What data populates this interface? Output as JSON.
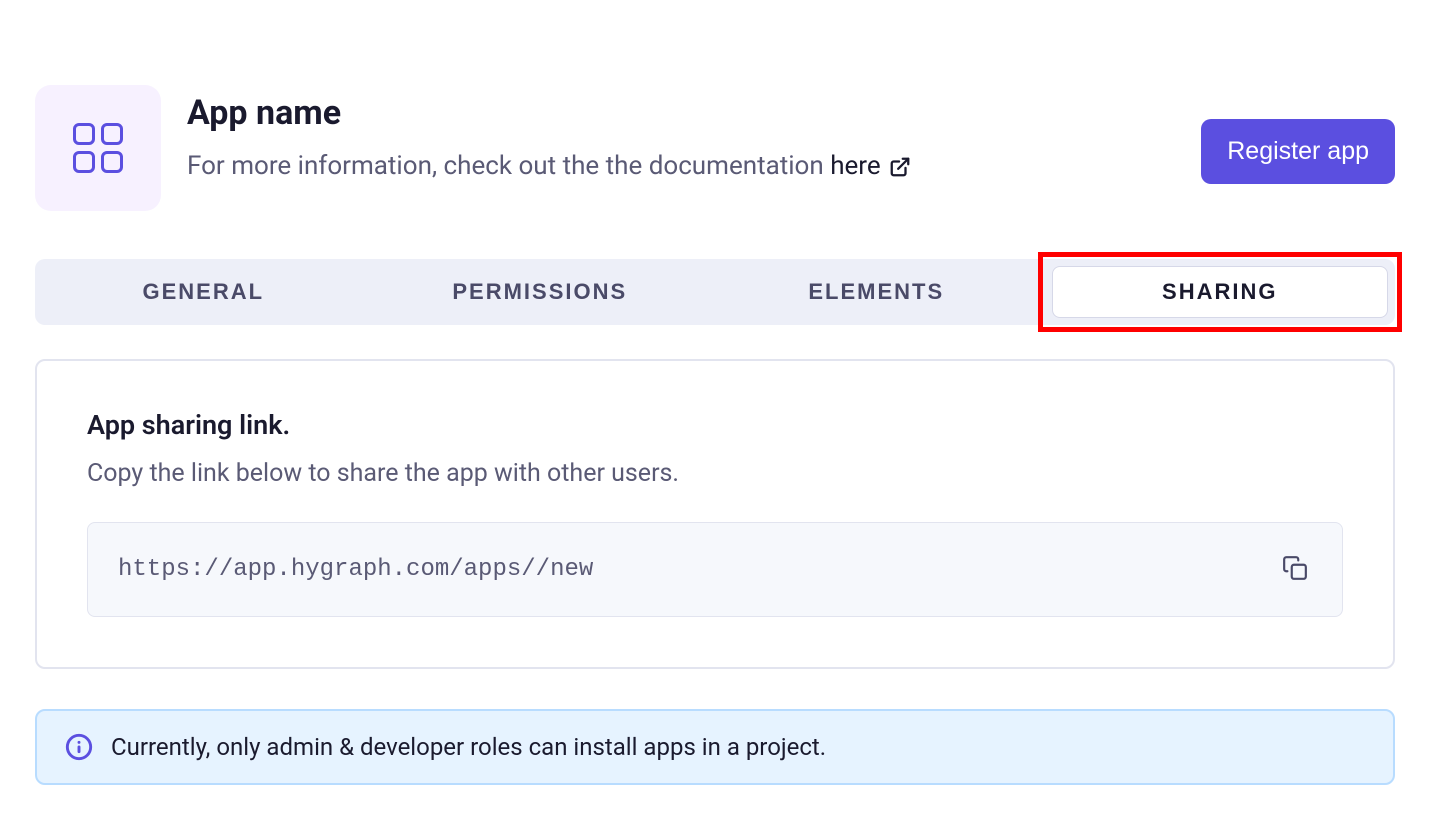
{
  "header": {
    "title": "App name",
    "subtitle_prefix": "For more information, check out the the documentation ",
    "doc_link_text": "here",
    "register_button": "Register app"
  },
  "tabs": {
    "general": "GENERAL",
    "permissions": "PERMISSIONS",
    "elements": "ELEMENTS",
    "sharing": "SHARING"
  },
  "sharing_card": {
    "title": "App sharing link.",
    "subtitle": "Copy the link below to share the app with other users.",
    "link_value": "https://app.hygraph.com/apps//new"
  },
  "info_banner": {
    "text": "Currently, only admin & developer roles can install apps in a project."
  },
  "colors": {
    "accent": "#5b4fe0",
    "highlight": "#ff0000",
    "info_bg": "#e6f3ff"
  }
}
